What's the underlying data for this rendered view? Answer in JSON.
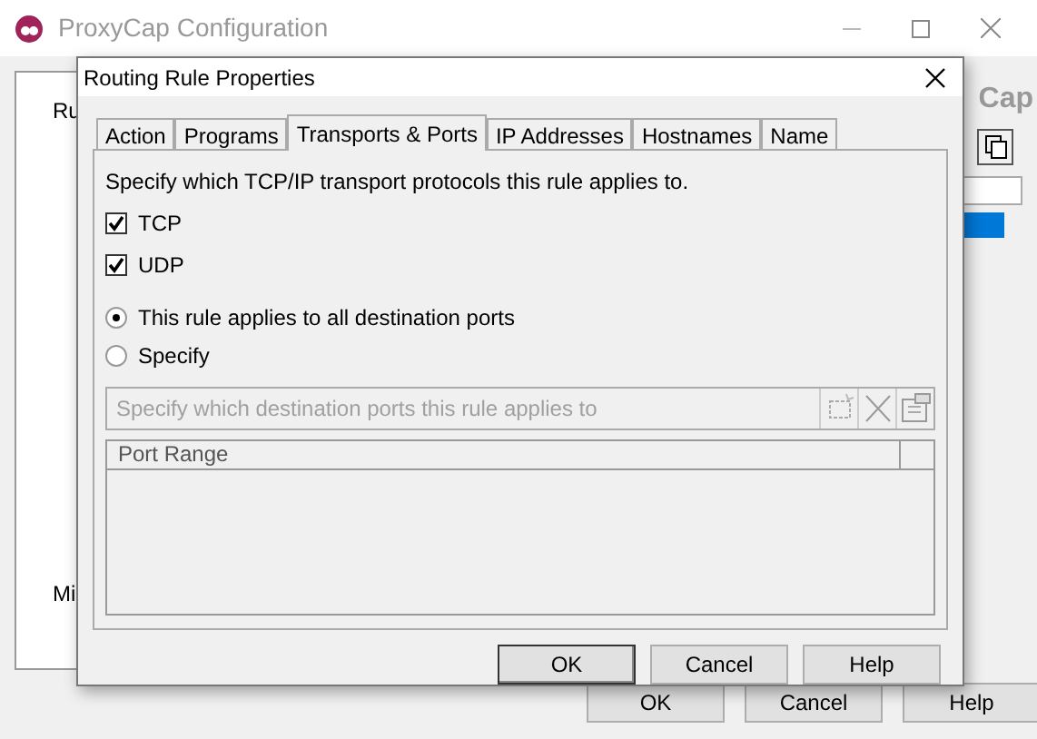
{
  "main_window": {
    "title": "ProxyCap Configuration",
    "tree_items": [
      "Ru",
      "Mi"
    ],
    "logo_text": "Cap",
    "list_rows": [
      {
        "selected": true
      }
    ],
    "buttons": [
      "OK",
      "Cancel",
      "Help"
    ]
  },
  "dialog": {
    "title": "Routing Rule Properties",
    "tabs": [
      {
        "label": "Action",
        "selected": false
      },
      {
        "label": "Programs",
        "selected": false
      },
      {
        "label": "Transports & Ports",
        "selected": true
      },
      {
        "label": "IP Addresses",
        "selected": false
      },
      {
        "label": "Hostnames",
        "selected": false
      },
      {
        "label": "Name",
        "selected": false
      }
    ],
    "protocols_label": "Specify which TCP/IP transport protocols this rule applies to.",
    "protocols": [
      {
        "label": "TCP",
        "checked": true
      },
      {
        "label": "UDP",
        "checked": true
      }
    ],
    "port_options": [
      {
        "label": "This rule applies to all destination ports",
        "selected": true
      },
      {
        "label": "Specify",
        "selected": false
      }
    ],
    "ports_field": {
      "placeholder": "Specify which destination ports this rule applies to",
      "disabled": true
    },
    "table": {
      "columns": [
        "Port Range"
      ]
    },
    "buttons": [
      "OK",
      "Cancel",
      "Help"
    ]
  }
}
